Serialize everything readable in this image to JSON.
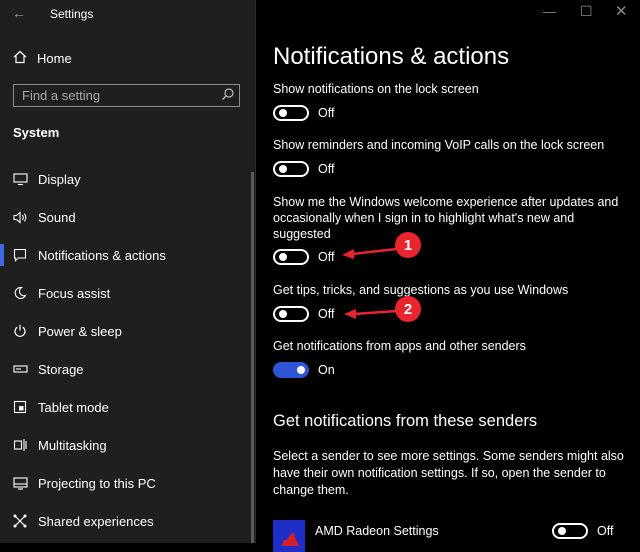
{
  "window": {
    "title": "Settings",
    "back_icon": "back-arrow-icon"
  },
  "sidebar": {
    "home_label": "Home",
    "search_placeholder": "Find a setting",
    "section_title": "System",
    "items": [
      {
        "label": "Display",
        "icon": "display-icon"
      },
      {
        "label": "Sound",
        "icon": "sound-icon"
      },
      {
        "label": "Notifications & actions",
        "icon": "notifications-icon",
        "active": true
      },
      {
        "label": "Focus assist",
        "icon": "focus-assist-icon"
      },
      {
        "label": "Power & sleep",
        "icon": "power-icon"
      },
      {
        "label": "Storage",
        "icon": "storage-icon"
      },
      {
        "label": "Tablet mode",
        "icon": "tablet-mode-icon"
      },
      {
        "label": "Multitasking",
        "icon": "multitasking-icon"
      },
      {
        "label": "Projecting to this PC",
        "icon": "projecting-icon"
      },
      {
        "label": "Shared experiences",
        "icon": "shared-experiences-icon"
      }
    ]
  },
  "main": {
    "title": "Notifications & actions",
    "settings": [
      {
        "label": "Show notifications on the lock screen",
        "state": "Off",
        "on": false
      },
      {
        "label": "Show reminders and incoming VoIP calls on the lock screen",
        "state": "Off",
        "on": false
      },
      {
        "label": "Show me the Windows welcome experience after updates and occasionally when I sign in to highlight what's new and suggested",
        "state": "Off",
        "on": false
      },
      {
        "label": "Get tips, tricks, and suggestions as you use Windows",
        "state": "Off",
        "on": false
      },
      {
        "label": "Get notifications from apps and other senders",
        "state": "On",
        "on": true
      }
    ],
    "senders_title": "Get notifications from these senders",
    "senders_desc": "Select a sender to see more settings. Some senders might also have their own notification settings. If so, open the sender to change them.",
    "senders": [
      {
        "name": "AMD Radeon Settings",
        "state": "Off",
        "on": false
      }
    ]
  },
  "annotations": [
    {
      "number": "1"
    },
    {
      "number": "2"
    }
  ],
  "colors": {
    "accent": "#2f55d4",
    "annotation": "#e8242d",
    "sidebar_bg": "#1f1f1f"
  }
}
